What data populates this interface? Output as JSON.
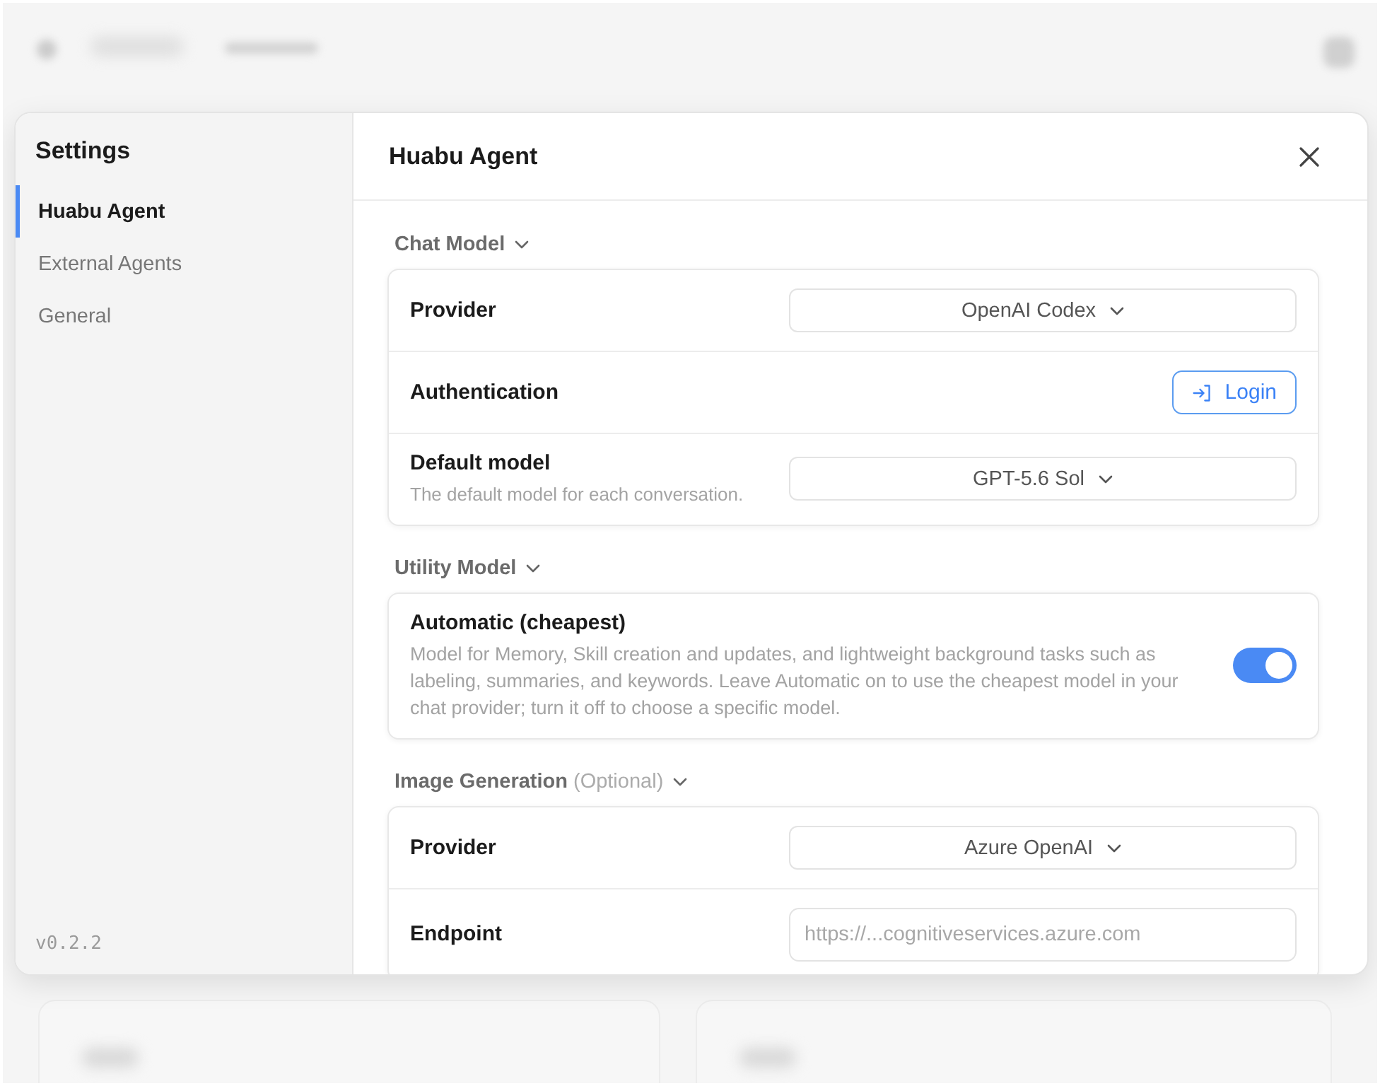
{
  "sidebar": {
    "title": "Settings",
    "items": [
      {
        "label": "Huabu Agent",
        "selected": true
      },
      {
        "label": "External Agents",
        "selected": false
      },
      {
        "label": "General",
        "selected": false
      }
    ],
    "version": "v0.2.2"
  },
  "panel": {
    "title": "Huabu Agent"
  },
  "sections": [
    {
      "title": "Chat Model",
      "expanded": true,
      "rows": [
        {
          "kind": "select",
          "label": "Provider",
          "value": "OpenAI Codex"
        },
        {
          "kind": "button",
          "label": "Authentication",
          "button": "Login"
        },
        {
          "kind": "select",
          "label": "Default model",
          "description": "The default model for each conversation.",
          "value": "GPT-5.6 Sol"
        }
      ]
    },
    {
      "title": "Utility Model",
      "expanded": true,
      "rows": [
        {
          "kind": "toggle",
          "label": "Automatic (cheapest)",
          "description": "Model for Memory, Skill creation and updates, and lightweight background tasks such as labeling, summaries, and keywords. Leave Automatic on to use the cheapest model in your chat provider; turn it off to choose a specific model.",
          "on": true
        }
      ]
    },
    {
      "title": "Image Generation",
      "note": "(Optional)",
      "expanded": true,
      "rows": [
        {
          "kind": "select",
          "label": "Provider",
          "value": "Azure OpenAI"
        },
        {
          "kind": "input",
          "label": "Endpoint",
          "placeholder": "https://...cognitiveservices.azure.com"
        }
      ]
    }
  ]
}
